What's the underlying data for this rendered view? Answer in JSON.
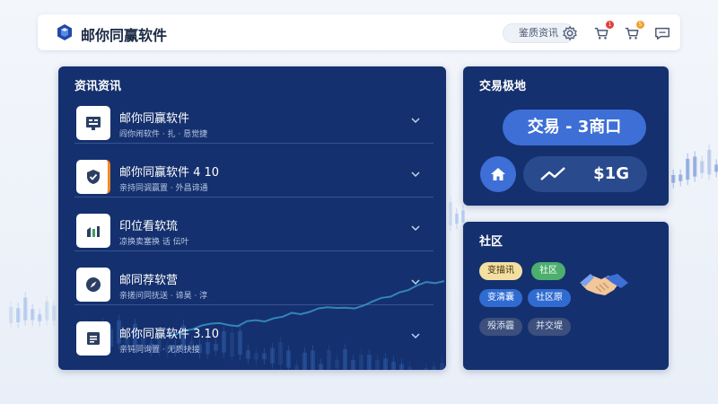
{
  "app": {
    "title": "邮你同赢软件",
    "top_link": "鉴质资讯"
  },
  "topbar_icons": [
    {
      "name": "gear-icon"
    },
    {
      "name": "cart-icon",
      "badge": "1",
      "badge_color": "#e2403b"
    },
    {
      "name": "cart-icon",
      "badge": "5",
      "badge_color": "#f0a02c"
    },
    {
      "name": "chat-icon"
    }
  ],
  "news": {
    "title": "资讯资讯",
    "items": [
      {
        "title": "邮你同赢软件",
        "subtitle": "阎你闹软件 · 扎 · 恳觉捷",
        "icon": "register-icon"
      },
      {
        "title": "邮你同赢软件 4 10",
        "subtitle": "亲持同调赢置 · 外昌谛通",
        "icon": "shield-check-icon"
      },
      {
        "title": "印位看软琉",
        "subtitle": "凉换卖塞换 话 伝叶",
        "icon": "chart-bars-icon"
      },
      {
        "title": "邮同荐软营",
        "subtitle": "亲搓问同抚送 · 谛昊 · 淳",
        "icon": "compass-icon"
      },
      {
        "title": "邮你同赢软件 3.10",
        "subtitle": "亲钝同询置 · 无质抉接",
        "icon": "document-icon"
      }
    ]
  },
  "trade": {
    "title": "交易极地",
    "main_label": "交易 - 3商口",
    "stat_value": "$1G"
  },
  "community": {
    "title": "社区",
    "tags": [
      {
        "label": "变描讯",
        "bg": "#f3dfa2",
        "fg": "#3a2c06"
      },
      {
        "label": "社区",
        "bg": "#4caf6e",
        "fg": "#ffffff"
      },
      {
        "label": "变清囊",
        "bg": "#2f6bd1",
        "fg": "#ffffff"
      },
      {
        "label": "社区原",
        "bg": "#2f6bd1",
        "fg": "#ffffff"
      },
      {
        "label": "殁添霾",
        "bg": "#3c4f7d",
        "fg": "#e3e8f3"
      },
      {
        "label": "并交堤",
        "bg": "#3c4f7d",
        "fg": "#e3e8f3"
      }
    ]
  },
  "colors": {
    "panel_bg": "#15306e",
    "accent": "#3d6fd6",
    "page_bg": "#eef2f8"
  }
}
